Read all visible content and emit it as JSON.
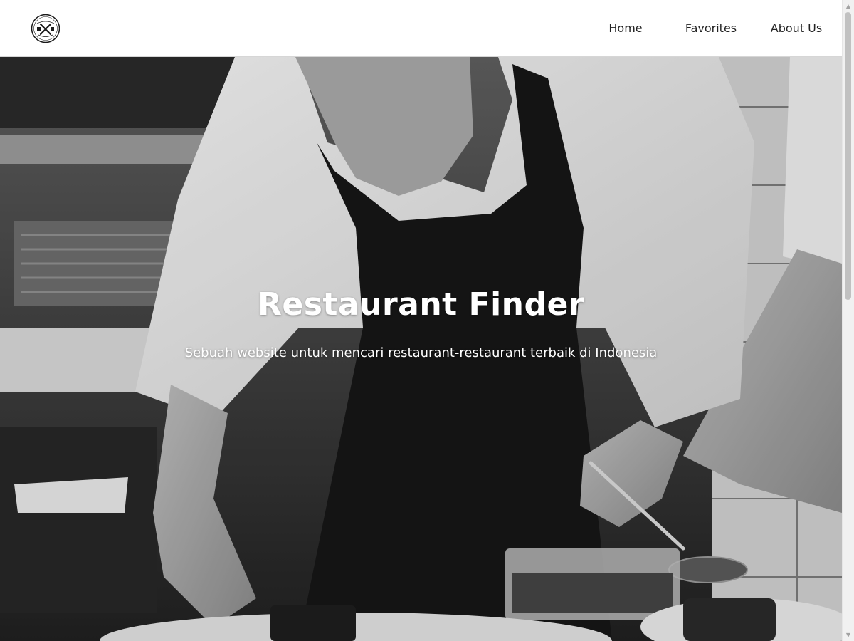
{
  "header": {
    "logo_icon": "restaurant-logo-icon",
    "nav": {
      "home": "Home",
      "favorites": "Favorites",
      "about": "About Us"
    }
  },
  "hero": {
    "title": "Restaurant Finder",
    "subtitle": "Sebuah website untuk mencari restaurant-restaurant terbaik di Indonesia",
    "image": "chef-plating-food-grayscale-photo"
  },
  "colors": {
    "header_bg": "#ffffff",
    "nav_text": "#222222",
    "hero_text": "#ffffff"
  },
  "scrollbar": {
    "thumb_icon": "scrollbar-thumb",
    "up_icon": "scroll-up-arrow-icon",
    "down_icon": "scroll-down-arrow-icon"
  }
}
